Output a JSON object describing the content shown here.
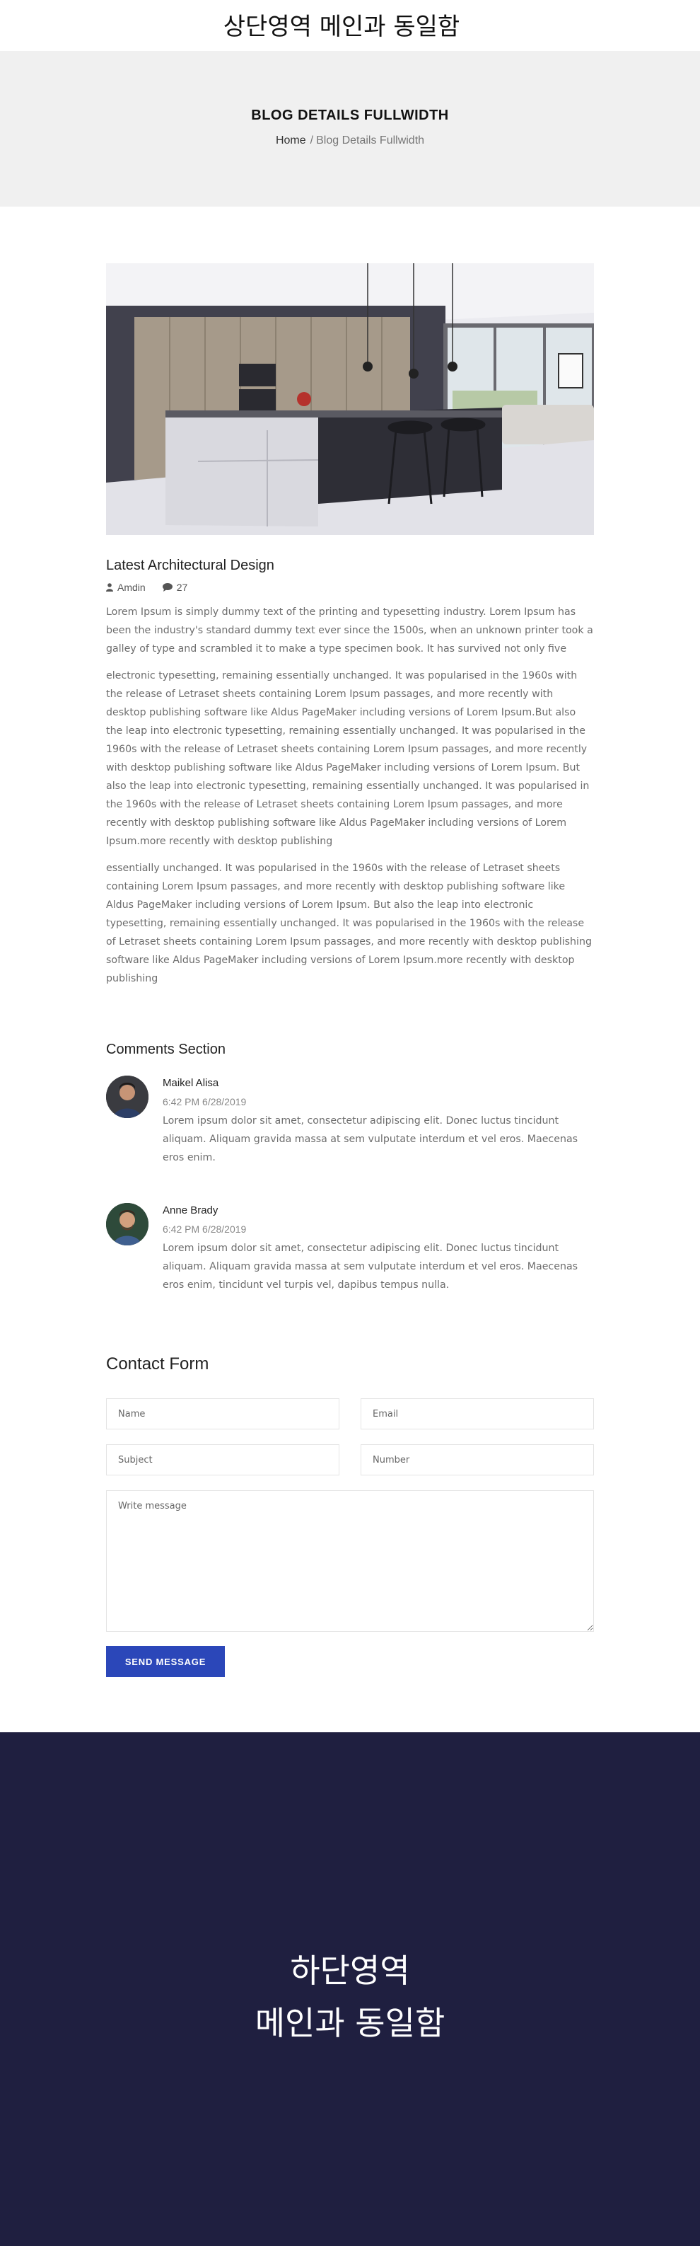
{
  "top_banner": {
    "text": "상단영역 메인과 동일함"
  },
  "page_header": {
    "title": "BLOG DETAILS FULLWIDTH",
    "breadcrumb": {
      "home": "Home",
      "separator": "/",
      "current": "Blog Details Fullwidth"
    }
  },
  "post": {
    "title": "Latest Architectural Design",
    "author": "Amdin",
    "comments_count": "27",
    "paragraphs": [
      "Lorem Ipsum is simply dummy text of the printing and typesetting industry. Lorem Ipsum has been the industry's standard dummy text ever since the 1500s, when an unknown printer took a galley of type and scrambled it to make a type specimen book. It has survived not only five",
      "electronic typesetting, remaining essentially unchanged. It was popularised in the 1960s with the release of Letraset sheets containing Lorem Ipsum passages, and more recently with desktop publishing software like Aldus PageMaker including versions of Lorem Ipsum.But also the leap into electronic typesetting, remaining essentially unchanged. It was popularised in the 1960s with the release of Letraset sheets containing Lorem Ipsum passages, and more recently with desktop publishing software like Aldus PageMaker including versions of Lorem Ipsum. But also the leap into electronic typesetting, remaining essentially unchanged. It was popularised in the 1960s with the release of Letraset sheets containing Lorem Ipsum passages, and more recently with desktop publishing software like Aldus PageMaker including versions of Lorem Ipsum.more recently with desktop publishing",
      "essentially unchanged. It was popularised in the 1960s with the release of Letraset sheets containing Lorem Ipsum passages, and more recently with desktop publishing software like Aldus PageMaker including versions of Lorem Ipsum. But also the leap into electronic typesetting, remaining essentially unchanged. It was popularised in the 1960s with the release of Letraset sheets containing Lorem Ipsum passages, and more recently with desktop publishing software like Aldus PageMaker including versions of Lorem Ipsum.more recently with desktop publishing"
    ]
  },
  "comments": {
    "title": "Comments Section",
    "items": [
      {
        "name": "Maikel Alisa",
        "date": "6:42 PM 6/28/2019",
        "text": "Lorem ipsum dolor sit amet, consectetur adipiscing elit. Donec luctus tincidunt aliquam. Aliquam gravida massa at sem vulputate interdum et vel eros. Maecenas eros enim."
      },
      {
        "name": "Anne Brady",
        "date": "6:42 PM 6/28/2019",
        "text": "Lorem ipsum dolor sit amet, consectetur adipiscing elit. Donec luctus tincidunt aliquam. Aliquam gravida massa at sem vulputate interdum et vel eros. Maecenas eros enim, tincidunt vel turpis vel, dapibus tempus nulla."
      }
    ]
  },
  "contact": {
    "title": "Contact Form",
    "name_placeholder": "Name",
    "email_placeholder": "Email",
    "subject_placeholder": "Subject",
    "number_placeholder": "Number",
    "message_placeholder": "Write message",
    "send_label": "SEND MESSAGE"
  },
  "footer": {
    "line1": "하단영역",
    "line2": "메인과 동일함"
  },
  "colors": {
    "accent": "#2b47b9",
    "footer_bg": "#1f1f40",
    "header_bg": "#f0f0f0"
  }
}
